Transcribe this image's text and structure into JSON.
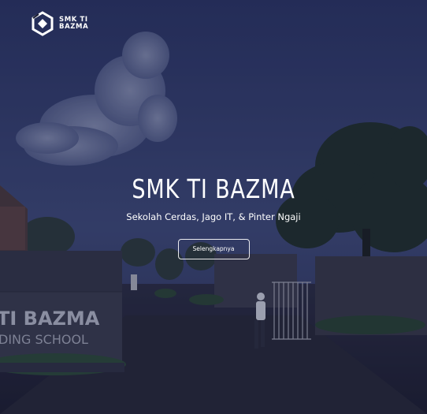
{
  "brand": {
    "logo_text_line1": "SMK TI",
    "logo_text_line2": "BAZMA"
  },
  "hero": {
    "title": "SMK TI BAZMA",
    "subtitle": "Sekolah Cerdas, Jago IT, & Pinter Ngaji",
    "cta_label": "Selengkapnya"
  },
  "background": {
    "sign_line1": "TI BAZMA",
    "sign_line2": "DING SCHOOL"
  },
  "colors": {
    "sky_top": "#2a3466",
    "sky_bottom": "#3d4a7a",
    "overlay": "#161834",
    "text": "#ffffff"
  }
}
